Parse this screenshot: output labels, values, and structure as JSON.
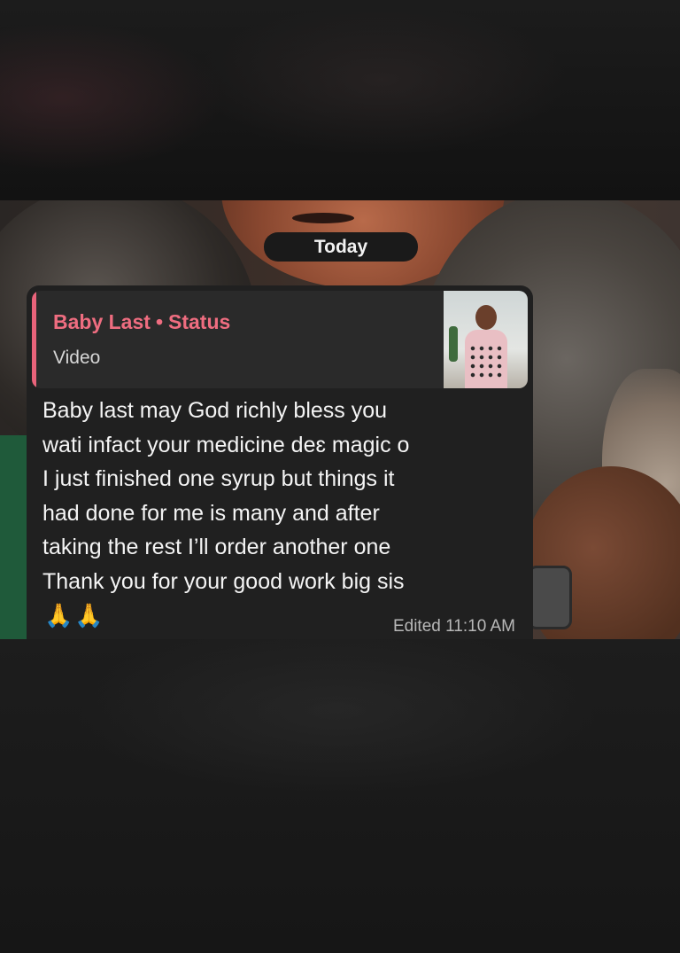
{
  "chat": {
    "date_label": "Today",
    "message": {
      "reply_quote": {
        "name": "Baby Last",
        "separator": "•",
        "source": "Status",
        "media_type": "Video",
        "accent_color": "#ef6d80"
      },
      "lines": [
        "Baby last may God richly bless you",
        "wati infact your medicine deɛ magic o",
        "I just finished one syrup but things it",
        "had done for me is many and after",
        "taking the rest I’ll order another one",
        "Thank you for your good work big sis"
      ],
      "emoji": "🙏🙏",
      "edited_label": "Edited",
      "time": "11:10 AM"
    }
  }
}
